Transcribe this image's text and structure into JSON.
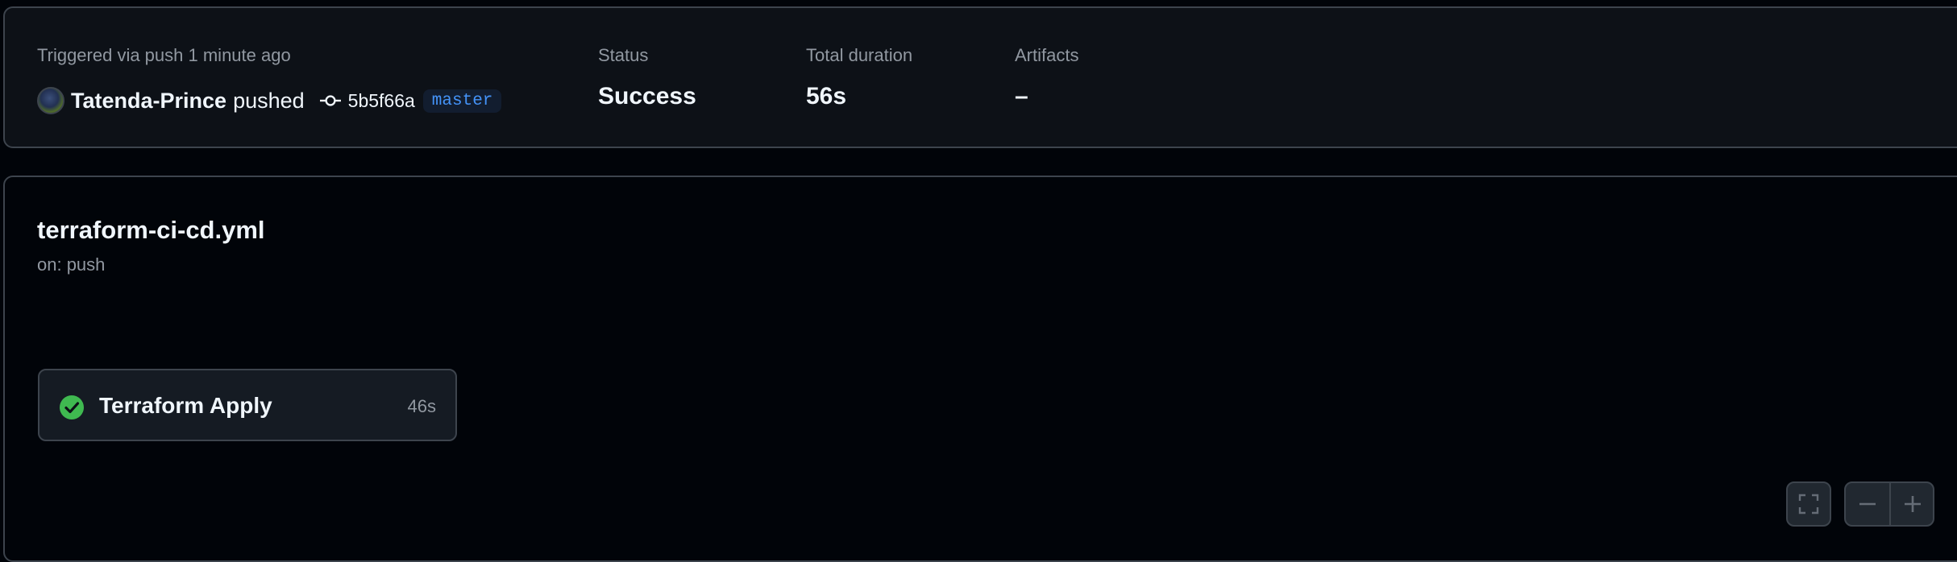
{
  "summary": {
    "trigger_text": "Triggered via push 1 minute ago",
    "actor": "Tatenda-Prince",
    "action": "pushed",
    "commit_sha": "5b5f66a",
    "branch": "master",
    "status_label": "Status",
    "status_value": "Success",
    "duration_label": "Total duration",
    "duration_value": "56s",
    "artifacts_label": "Artifacts",
    "artifacts_value": "–"
  },
  "workflow": {
    "file_name": "terraform-ci-cd.yml",
    "trigger": "on: push",
    "jobs": [
      {
        "name": "Terraform Apply",
        "duration": "46s",
        "status": "success"
      }
    ]
  },
  "icons": {
    "commit": "git-commit-icon",
    "job_status": "check-circle-fill-icon",
    "fullscreen": "screen-full-icon",
    "zoom_out": "dash-icon",
    "zoom_in": "plus-icon"
  },
  "colors": {
    "success": "#238636",
    "branch_text": "#4493f8",
    "branch_bg": "#121d2f",
    "background": "#010409",
    "card_bg": "#0d1117",
    "border": "#3d444d"
  }
}
